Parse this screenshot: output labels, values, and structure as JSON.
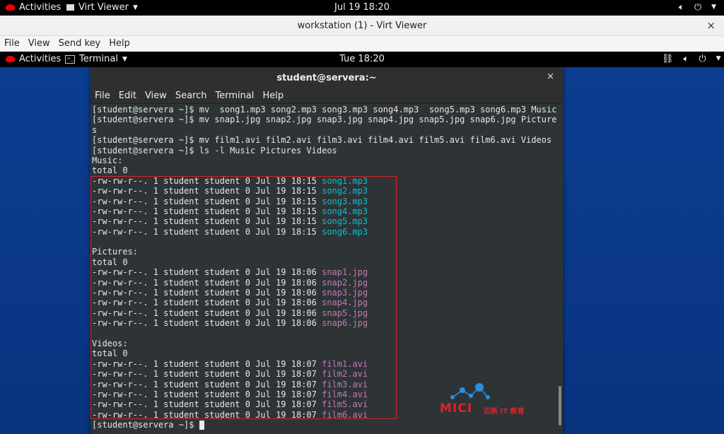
{
  "host_bar": {
    "activities": "Activities",
    "app_menu": "Virt Viewer",
    "clock": "Jul 19  18:20"
  },
  "virt_viewer": {
    "title": "workstation (1) - Virt Viewer",
    "close": "×",
    "menu": [
      "File",
      "View",
      "Send key",
      "Help"
    ]
  },
  "guest_bar": {
    "activities": "Activities",
    "app_menu": "Terminal",
    "clock": "Tue 18:20"
  },
  "terminal": {
    "title": "student@servera:~",
    "close": "×",
    "menu": [
      "File",
      "Edit",
      "View",
      "Search",
      "Terminal",
      "Help"
    ],
    "lines": [
      {
        "text": "[student@servera ~]$ mv  song1.mp3 song2.mp3 song3.mp3 song4.mp3  song5.mp3 song6.mp3 Music"
      },
      {
        "text": "[student@servera ~]$ mv snap1.jpg snap2.jpg snap3.jpg snap4.jpg snap5.jpg snap6.jpg Picture"
      },
      {
        "text": "s"
      },
      {
        "text": "[student@servera ~]$ mv film1.avi film2.avi film3.avi film4.avi film5.avi film6.avi Videos"
      },
      {
        "text": "[student@servera ~]$ ls -l Music Pictures Videos"
      },
      {
        "text": "Music:"
      },
      {
        "text": "total 0"
      },
      {
        "text": "-rw-rw-r--. 1 student student 0 Jul 19 18:15 ",
        "file": "song1.mp3",
        "kind": "audio"
      },
      {
        "text": "-rw-rw-r--. 1 student student 0 Jul 19 18:15 ",
        "file": "song2.mp3",
        "kind": "audio"
      },
      {
        "text": "-rw-rw-r--. 1 student student 0 Jul 19 18:15 ",
        "file": "song3.mp3",
        "kind": "audio"
      },
      {
        "text": "-rw-rw-r--. 1 student student 0 Jul 19 18:15 ",
        "file": "song4.mp3",
        "kind": "audio"
      },
      {
        "text": "-rw-rw-r--. 1 student student 0 Jul 19 18:15 ",
        "file": "song5.mp3",
        "kind": "audio"
      },
      {
        "text": "-rw-rw-r--. 1 student student 0 Jul 19 18:15 ",
        "file": "song6.mp3",
        "kind": "audio"
      },
      {
        "text": ""
      },
      {
        "text": "Pictures:"
      },
      {
        "text": "total 0"
      },
      {
        "text": "-rw-rw-r--. 1 student student 0 Jul 19 18:06 ",
        "file": "snap1.jpg",
        "kind": "img"
      },
      {
        "text": "-rw-rw-r--. 1 student student 0 Jul 19 18:06 ",
        "file": "snap2.jpg",
        "kind": "img"
      },
      {
        "text": "-rw-rw-r--. 1 student student 0 Jul 19 18:06 ",
        "file": "snap3.jpg",
        "kind": "img"
      },
      {
        "text": "-rw-rw-r--. 1 student student 0 Jul 19 18:06 ",
        "file": "snap4.jpg",
        "kind": "img"
      },
      {
        "text": "-rw-rw-r--. 1 student student 0 Jul 19 18:06 ",
        "file": "snap5.jpg",
        "kind": "img"
      },
      {
        "text": "-rw-rw-r--. 1 student student 0 Jul 19 18:06 ",
        "file": "snap6.jpg",
        "kind": "img"
      },
      {
        "text": ""
      },
      {
        "text": "Videos:"
      },
      {
        "text": "total 0"
      },
      {
        "text": "-rw-rw-r--. 1 student student 0 Jul 19 18:07 ",
        "file": "film1.avi",
        "kind": "vid"
      },
      {
        "text": "-rw-rw-r--. 1 student student 0 Jul 19 18:07 ",
        "file": "film2.avi",
        "kind": "vid"
      },
      {
        "text": "-rw-rw-r--. 1 student student 0 Jul 19 18:07 ",
        "file": "film3.avi",
        "kind": "vid"
      },
      {
        "text": "-rw-rw-r--. 1 student student 0 Jul 19 18:07 ",
        "file": "film4.avi",
        "kind": "vid"
      },
      {
        "text": "-rw-rw-r--. 1 student student 0 Jul 19 18:07 ",
        "file": "film5.avi",
        "kind": "vid"
      },
      {
        "text": "-rw-rw-r--. 1 student student 0 Jul 19 18:07 ",
        "file": "film6.avi",
        "kind": "vid"
      }
    ],
    "prompt": "[student@servera ~]$ "
  },
  "watermark": {
    "word": "MICI",
    "sub": "迈斯 IT 教育"
  },
  "colors": {
    "audio": "#06c1cf",
    "image": "#c678b4",
    "video": "#c678b4",
    "highlight": "#dd2222",
    "desktop": "#0b3a8a"
  }
}
